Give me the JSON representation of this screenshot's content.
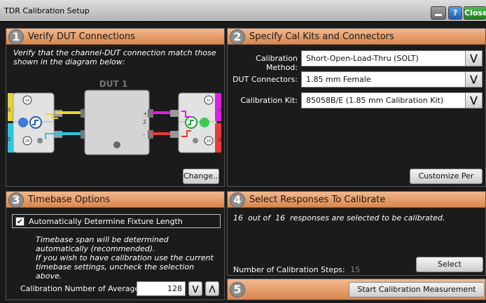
{
  "window": {
    "title": "TDR Calibration Setup",
    "help_label": "?",
    "close_label": "Close"
  },
  "section1": {
    "number": "1",
    "title": "Verify DUT Connections",
    "instruction": "Verify that the channel-DUT connection match those shown in the diagram below:",
    "dut_label": "DUT 1",
    "change_label": "Change...",
    "ports": {
      "left_top": "1",
      "left_bottom": "1",
      "right_top": "1",
      "right_bottom": "1",
      "channel_1": "1A",
      "channel_2": "1B",
      "channel_3": "1C",
      "channel_4": "1D",
      "chan_tag_1": "1A",
      "chan_tag_2": "1B",
      "chan_tag_3": "1C",
      "chan_tag_4": "1D",
      "pin_plus_left": "+",
      "pin_minus_left": "-",
      "pin_plus_right": "+",
      "pin_minus_right": "-",
      "num_left": "1",
      "num_right": "2"
    }
  },
  "section2": {
    "number": "2",
    "title": "Specify Cal Kits and Connectors",
    "method_label": "Calibration Method:",
    "method_value": "Short-Open-Load-Thru (SOLT)",
    "connectors_label": "DUT Connectors:",
    "connectors_value": "1.85 mm Female",
    "kit_label": "Calibration Kit:",
    "kit_value": "85058B/E (1.85 mm Calibration Kit)",
    "customize_label": "Customize Per Port..."
  },
  "section3": {
    "number": "3",
    "title": "Timebase Options",
    "auto_label": "Automatically Determine Fixture Length",
    "auto_checked": true,
    "info_1": "Timebase span will be determined automatically (recommended).",
    "info_2": "If you wish to have calibration use the current timebase settings, uncheck the selection above.",
    "averages_label": "Calibration Number of Averages:",
    "averages_value": "128"
  },
  "section4": {
    "number": "4",
    "title": "Select Responses To Calibrate",
    "summary": "16  out of  16  responses are selected to be calibrated.",
    "steps_label": "Number of Calibration Steps:",
    "steps_value": "15",
    "select_label": "Select responses..."
  },
  "section5": {
    "number": "5",
    "wizard_label": "Start Calibration Measurement Wizard..."
  },
  "colors": {
    "header_orange": "#d9874f",
    "yellow": "#e6d23c",
    "cyan": "#29c8e0",
    "magenta": "#e01ee0",
    "red": "#e83a3a"
  }
}
